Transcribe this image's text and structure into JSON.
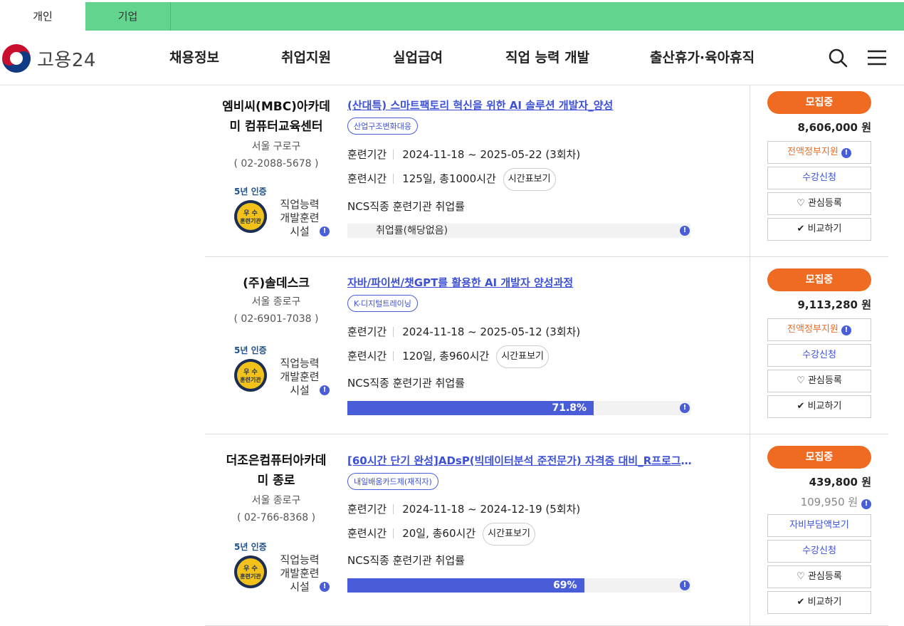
{
  "top_tabs": {
    "personal": "개인",
    "corporate": "기업"
  },
  "header": {
    "logo_text": "고용24",
    "nav": [
      "채용정보",
      "취업지원",
      "실업급여",
      "직업 능력 개발",
      "출산휴가·육아휴직"
    ]
  },
  "labels": {
    "period": "훈련기간",
    "time": "훈련시간",
    "timetable": "시간표보기",
    "ncs": "NCS직종 훈련기관 취업률",
    "badge_year": "5년",
    "badge_cert": "인증",
    "medal_top": "우 수",
    "medal_bottom": "훈련기관",
    "badge_line1": "직업능력",
    "badge_line2": "개발훈련",
    "badge_line3": "시설",
    "recruiting": "모집중",
    "won": "원",
    "gov_support": "전액정부지원",
    "self_pay": "자비부담액보기",
    "apply": "수강신청",
    "interest": "관심등록",
    "compare": "비교하기",
    "no_rate": "취업률(해당없음)"
  },
  "courses": [
    {
      "inst_name_1": "엠비씨(MBC)아카데",
      "inst_name_2": "미 컴퓨터교육센터",
      "region": "서울 구로구",
      "phone": "( 02-2088-5678 )",
      "title": "(산대특) 스마트팩토리 혁신을 위한 AI 솔루션 개발자_양성",
      "tag": "산업구조변화대응",
      "period": "2024-11-18 ~ 2025-05-22 (3회차)",
      "hours": "125일, 총1000시간",
      "rate": null,
      "rate_label": "",
      "price": "8,606,000",
      "price_sub": ""
    },
    {
      "inst_name_1": "(주)솔데스크",
      "inst_name_2": "",
      "region": "서울 종로구",
      "phone": "( 02-6901-7038 )",
      "title": "자바/파이썬/챗GPT를 활용한 AI 개발자 양성과정",
      "tag": "K-디지털트레이닝",
      "period": "2024-11-18 ~ 2025-05-12 (3회차)",
      "hours": "120일, 총960시간",
      "rate": 71.8,
      "rate_label": "71.8%",
      "price": "9,113,280",
      "price_sub": ""
    },
    {
      "inst_name_1": "더조은컴퓨터아카데",
      "inst_name_2": "미 종로",
      "region": "서울 종로구",
      "phone": "( 02-766-8368 )",
      "title": "[60시간 단기 완성]ADsP(빅데이터분석 준전문가) 자격증 대비_R프로그래밍 ...",
      "tag": "내일배움카드제(재직자)",
      "period": "2024-11-18 ~ 2024-12-19 (5회차)",
      "hours": "20일, 총60시간",
      "rate": 69,
      "rate_label": "69%",
      "price": "439,800",
      "price_sub": "109,950"
    }
  ],
  "colors": {
    "accent_green": "#62d48e",
    "blue": "#3d51d6",
    "orange": "#f06b22"
  }
}
